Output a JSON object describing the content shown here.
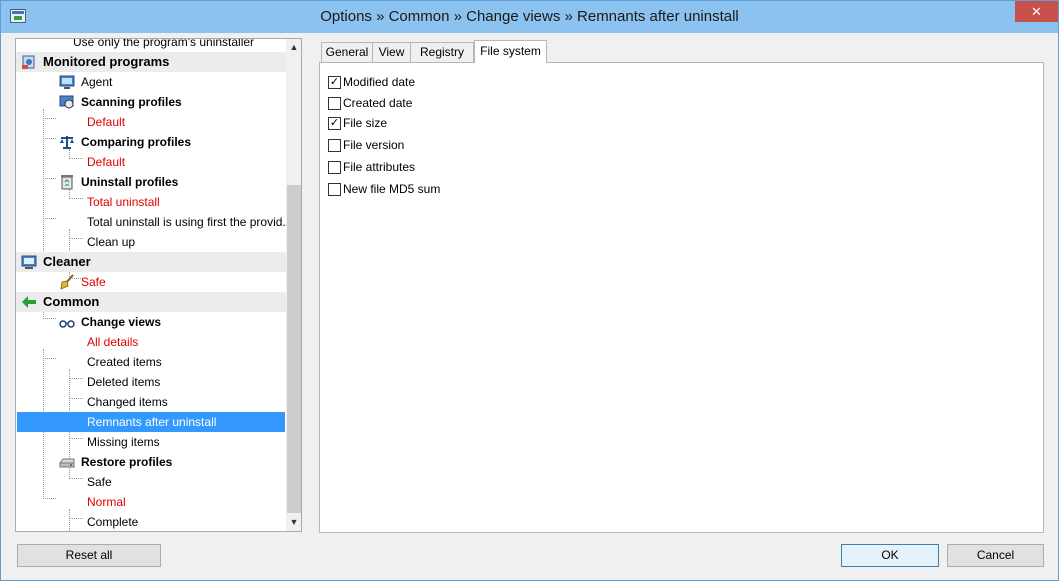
{
  "window": {
    "title": "Options » Common » Change views » Remnants after uninstall",
    "close_glyph": "✕"
  },
  "tree": {
    "rows": [
      {
        "label": "Use only the program's uninstaller"
      },
      {
        "label": "Monitored programs"
      },
      {
        "label": "Agent"
      },
      {
        "label": "Scanning profiles"
      },
      {
        "label": "Default"
      },
      {
        "label": "Comparing profiles"
      },
      {
        "label": "Default"
      },
      {
        "label": "Uninstall profiles"
      },
      {
        "label": "Total uninstall"
      },
      {
        "label": "Total uninstall is using first the provid..."
      },
      {
        "label": "Clean up"
      },
      {
        "label": "Cleaner"
      },
      {
        "label": "Safe"
      },
      {
        "label": "Common"
      },
      {
        "label": "Change views"
      },
      {
        "label": "All details"
      },
      {
        "label": "Created items"
      },
      {
        "label": "Deleted items"
      },
      {
        "label": "Changed items"
      },
      {
        "label": "Remnants after uninstall"
      },
      {
        "label": "Missing items"
      },
      {
        "label": "Restore profiles"
      },
      {
        "label": "Safe"
      },
      {
        "label": "Normal"
      },
      {
        "label": "Complete"
      }
    ],
    "scroll_up_glyph": "▲",
    "scroll_down_glyph": "▼"
  },
  "tabs": [
    {
      "label": "General",
      "active": false
    },
    {
      "label": "View",
      "active": false
    },
    {
      "label": "Registry",
      "active": false
    },
    {
      "label": "File system",
      "active": true
    }
  ],
  "options": [
    {
      "label": "Modified date",
      "checked": true
    },
    {
      "label": "Created date",
      "checked": false
    },
    {
      "label": "File size",
      "checked": true
    },
    {
      "label": "File version",
      "checked": false
    },
    {
      "label": "File attributes",
      "checked": false
    },
    {
      "label": "New file MD5 sum",
      "checked": false
    }
  ],
  "check_glyph": "✓",
  "buttons": {
    "reset_all": "Reset all",
    "ok": "OK",
    "cancel": "Cancel"
  },
  "colors": {
    "selection": "#3399ff",
    "red_item": "#e00000",
    "header_row": "#ececec"
  }
}
